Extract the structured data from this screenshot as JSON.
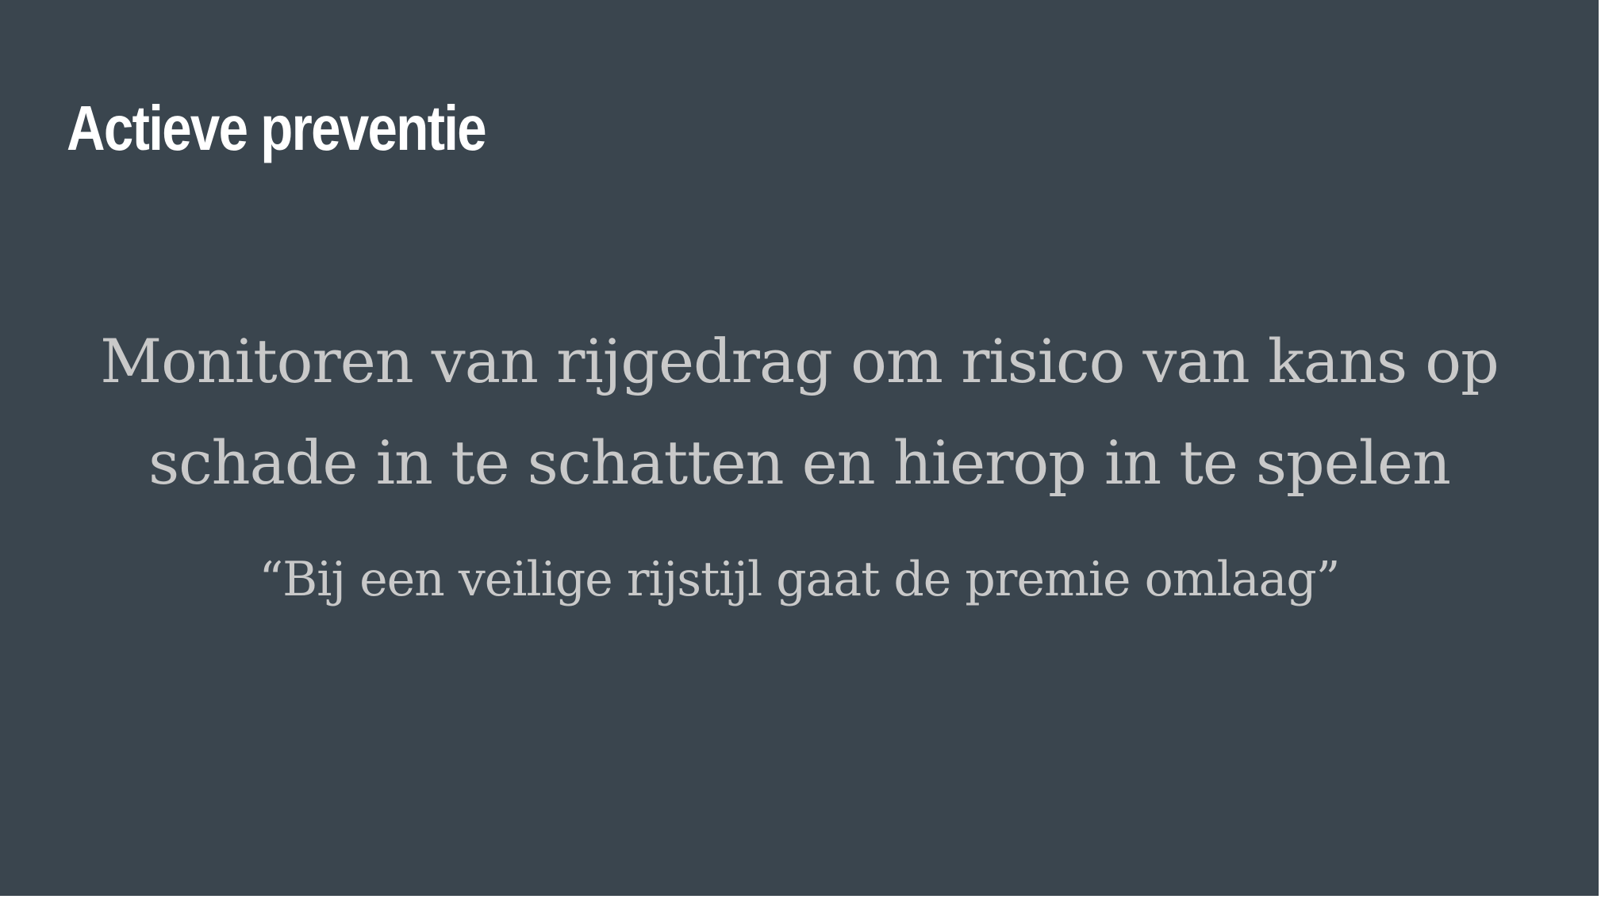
{
  "slide": {
    "title": "Actieve preventie",
    "statement": "Monitoren van rijgedrag om risico van kans op schade in te schatten en hierop in te spelen",
    "quote": "“Bij een veilige rijstijl gaat de premie omlaag”"
  },
  "colors": {
    "background": "#3a454e",
    "title": "#ffffff",
    "body": "#c9c9c9"
  }
}
